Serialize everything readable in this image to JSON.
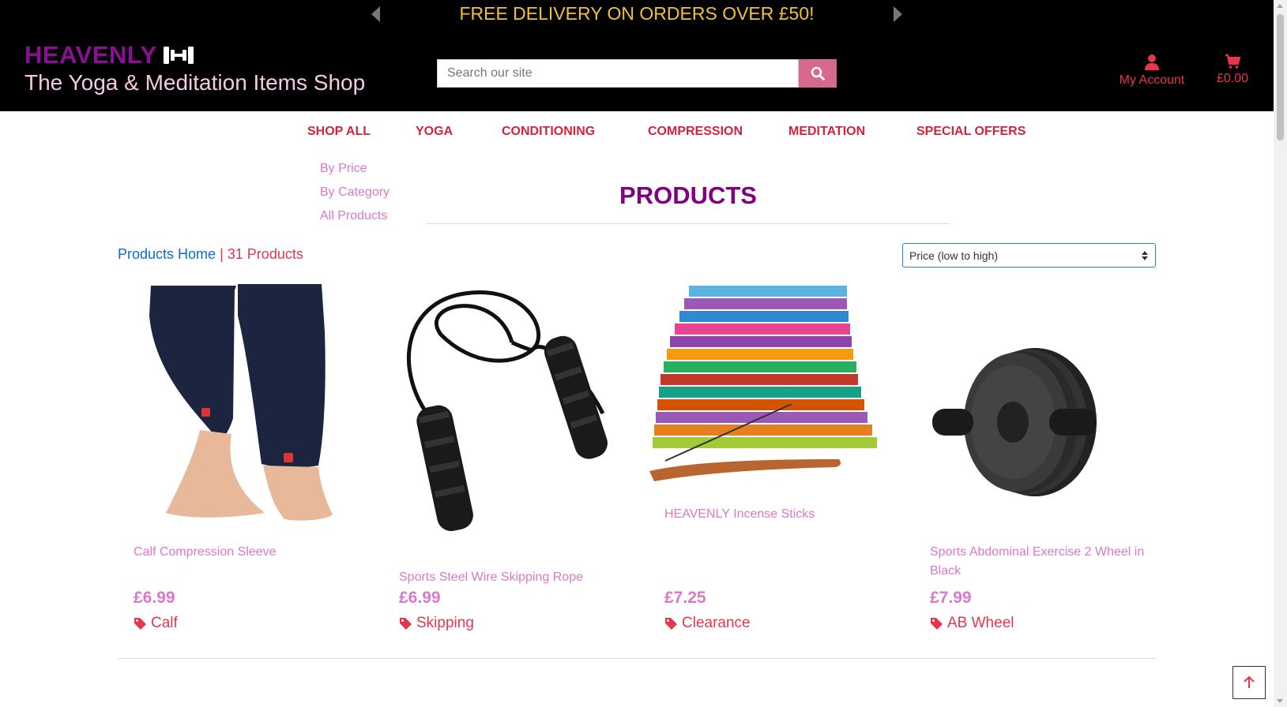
{
  "banner": {
    "text": "FREE DELIVERY ON ORDERS OVER £50!",
    "prev_icon": "chevron-left-icon",
    "next_icon": "chevron-right-icon",
    "color": "#f1c232"
  },
  "brand": {
    "name": "HEAVENLY",
    "icon": "dumbbell-icon",
    "tagline": "The Yoga & Meditation Items Shop",
    "name_color": "#8a0f92",
    "tagline_color": "#f6c9e4"
  },
  "search": {
    "placeholder": "Search our site",
    "icon": "search-icon",
    "button_color": "#d66a8e"
  },
  "account": {
    "label": "My Account",
    "icon": "user-icon"
  },
  "bag": {
    "total": "£0.00",
    "icon": "shopping-cart-icon"
  },
  "nav": {
    "items": [
      {
        "label": "SHOP ALL"
      },
      {
        "label": "YOGA"
      },
      {
        "label": "CONDITIONING"
      },
      {
        "label": "COMPRESSION"
      },
      {
        "label": "MEDITATION"
      },
      {
        "label": "SPECIAL OFFERS"
      }
    ],
    "color": "#d3243d"
  },
  "shop_all_menu": {
    "items": [
      {
        "label": "By Price"
      },
      {
        "label": "By Category"
      },
      {
        "label": "All Products"
      }
    ]
  },
  "page": {
    "title": "PRODUCTS",
    "title_color": "#800080"
  },
  "breadcrumb": {
    "home_label": "Products Home",
    "separator": "|",
    "count_label": "31 Products"
  },
  "sort": {
    "selected": "Price (low to high)",
    "icon": "sort-arrows-icon"
  },
  "products": [
    {
      "name": "Calf Compression Sleeve",
      "price": "£6.99",
      "category": "Calf",
      "image_icon": "compression-sleeve-image"
    },
    {
      "name": "Sports Steel Wire Skipping Rope",
      "price": "£6.99",
      "category": "Skipping",
      "image_icon": "skipping-rope-image"
    },
    {
      "name": "HEAVENLY Incense Sticks",
      "price": "£7.25",
      "category": "Clearance",
      "image_icon": "incense-sticks-image"
    },
    {
      "name": "Sports Abdominal Exercise 2 Wheel in Black",
      "price": "£7.99",
      "category": "AB Wheel",
      "image_icon": "ab-wheel-image"
    }
  ],
  "tag_icon": "tag-icon",
  "back_to_top": {
    "icon": "arrow-up-icon"
  },
  "colors": {
    "accent_red": "#e5364c",
    "link_blue": "#0d6bcd",
    "pink": "#d978cc"
  }
}
